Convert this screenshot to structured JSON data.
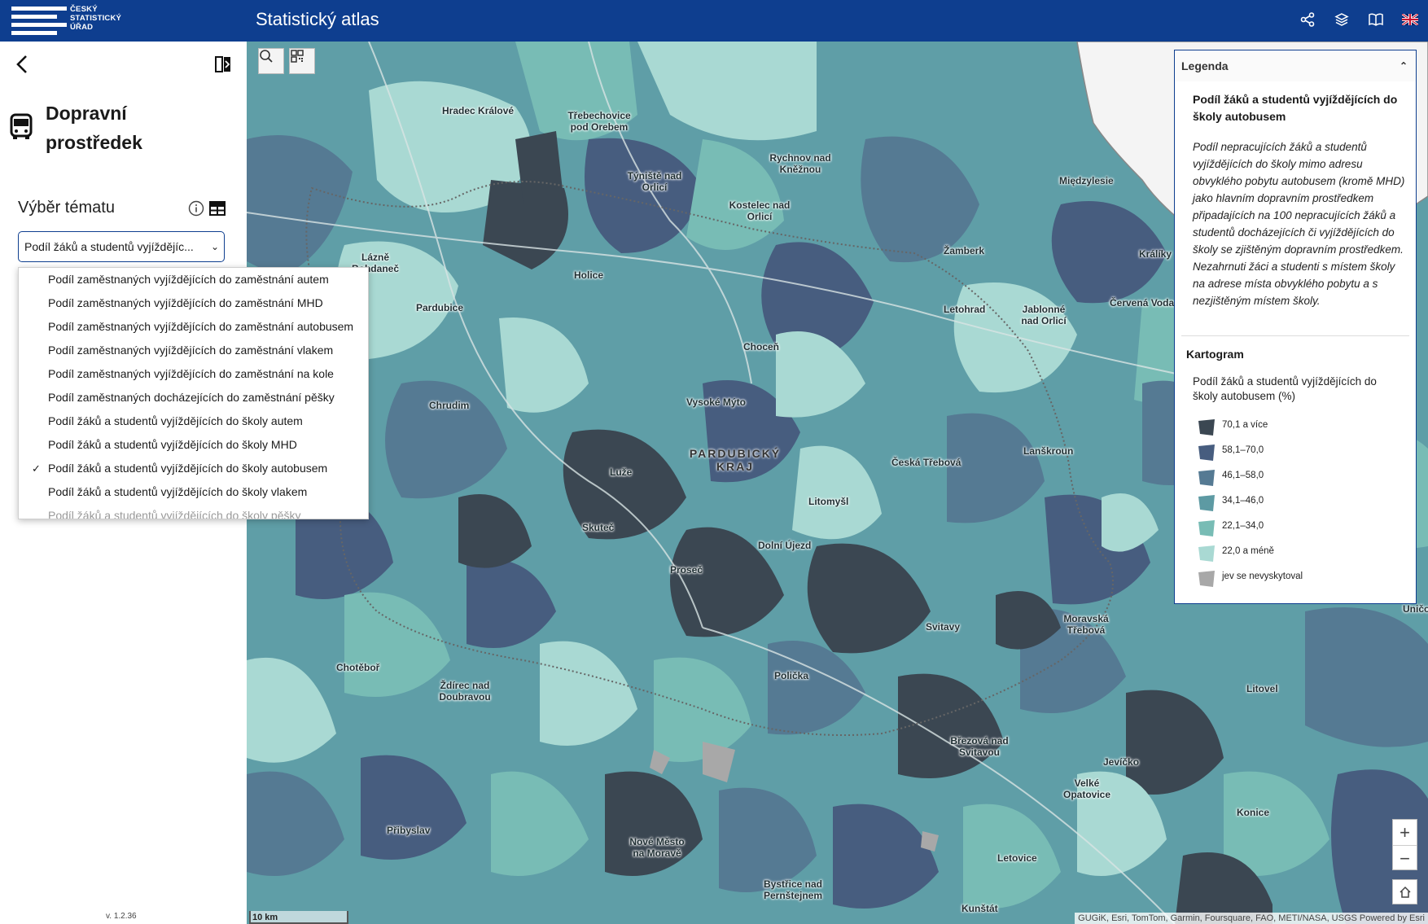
{
  "header": {
    "logo_lines": [
      "ČESKÝ",
      "STATISTICKÝ",
      "ÚŘAD"
    ],
    "title": "Statistický atlas",
    "icons": [
      "share-icon",
      "layers-icon",
      "book-icon",
      "english-flag-icon"
    ]
  },
  "sidebar": {
    "theme_title": "Dopravní prostředek",
    "theme_icon": "bus-icon",
    "topic_label": "Výběr tématu",
    "select_value": "Podíl žáků a studentů vyjíždějících do školy autobusem",
    "select_display": "Podíl žáků a studentů vyjíždějíc...",
    "version": "v. 1.2.36"
  },
  "dropdown": {
    "items": [
      "Podíl zaměstnaných vyjíždějících do zaměstnání autem",
      "Podíl zaměstnaných vyjíždějících do zaměstnání MHD",
      "Podíl zaměstnaných vyjíždějících do zaměstnání autobusem",
      "Podíl zaměstnaných vyjíždějících do zaměstnání vlakem",
      "Podíl zaměstnaných vyjíždějících do zaměstnání na kole",
      "Podíl zaměstnaných docházejících do zaměstnání pěšky",
      "Podíl žáků a studentů vyjíždějících do školy autem",
      "Podíl žáků a studentů vyjíždějících do školy MHD",
      "Podíl žáků a studentů vyjíždějících do školy autobusem",
      "Podíl žáků a studentů vyjíždějících do školy vlakem",
      "Podíl žáků a studentů vyjíždějících do školy pěšky"
    ],
    "selected_index": 8
  },
  "map": {
    "place_names": [
      "Hradec Králové",
      "Třebechovice pod Orebem",
      "Týniště nad Orlicí",
      "Rychnov nad Kněžnou",
      "Kostelec nad Orlicí",
      "Międzylesie",
      "Žamberk",
      "Králíky",
      "Lázně Bohdaneč",
      "Holice",
      "Pardubice",
      "Letohrad",
      "Jablonné nad Orlicí",
      "Červená Voda",
      "Choceň",
      "Vysoké Mýto",
      "Chrudim",
      "Lanškroun",
      "Česká Třebová",
      "Luže",
      "Litomyšl",
      "Skuteč",
      "Dolní Újezd",
      "Proseč",
      "Svitavy",
      "Moravská Třebová",
      "Chotěboř",
      "Polička",
      "Ždírec nad Doubravou",
      "Litovel",
      "Březová nad Svitavou",
      "Jevíčko",
      "Velké Opatovice",
      "Konice",
      "Přibyslav",
      "Nové Město na Moravě",
      "Letovice",
      "Bystřice nad Pernštejnem",
      "Kunštát",
      "Uničov"
    ],
    "region_name": "PARDUBICKÝ KRAJ",
    "scale": "10 km",
    "attribution": "GUGiK, Esri, TomTom, Garmin, Foursquare, FAO, METI/NASA, USGS   Powered by Esri"
  },
  "legend": {
    "header": "Legenda",
    "layer_title": "Podíl žáků a studentů vyjíždějících do školy autobusem",
    "description": "Podíl nepracujících žáků a studentů vyjíždějících do školy mimo adresu obvyklého pobytu autobusem (kromě MHD) jako hlavním dopravním prostředkem připadajících na 100 nepracujících žáků a studentů docházejících či vyjíždějících do školy se zjištěným dopravním prostředkem. Nezahrnuti žáci a studenti s místem školy na adrese místa obvyklého pobytu a s nezjištěným místem školy.",
    "kartogram_label": "Kartogram",
    "subtitle": "Podíl žáků a studentů vyjíždějících do školy autobusem (%)",
    "classes": [
      {
        "label": "70,1 a více",
        "color": "#3b4752"
      },
      {
        "label": "58,1–70,0",
        "color": "#475d7f"
      },
      {
        "label": "46,1–58,0",
        "color": "#557a93"
      },
      {
        "label": "34,1–46,0",
        "color": "#5d9aa3"
      },
      {
        "label": "22,1–34,0",
        "color": "#78bcb5"
      },
      {
        "label": "22,0 a méně",
        "color": "#a9d9d3"
      },
      {
        "label": "jev se nevyskytoval",
        "color": "#a8a8a8"
      }
    ]
  }
}
